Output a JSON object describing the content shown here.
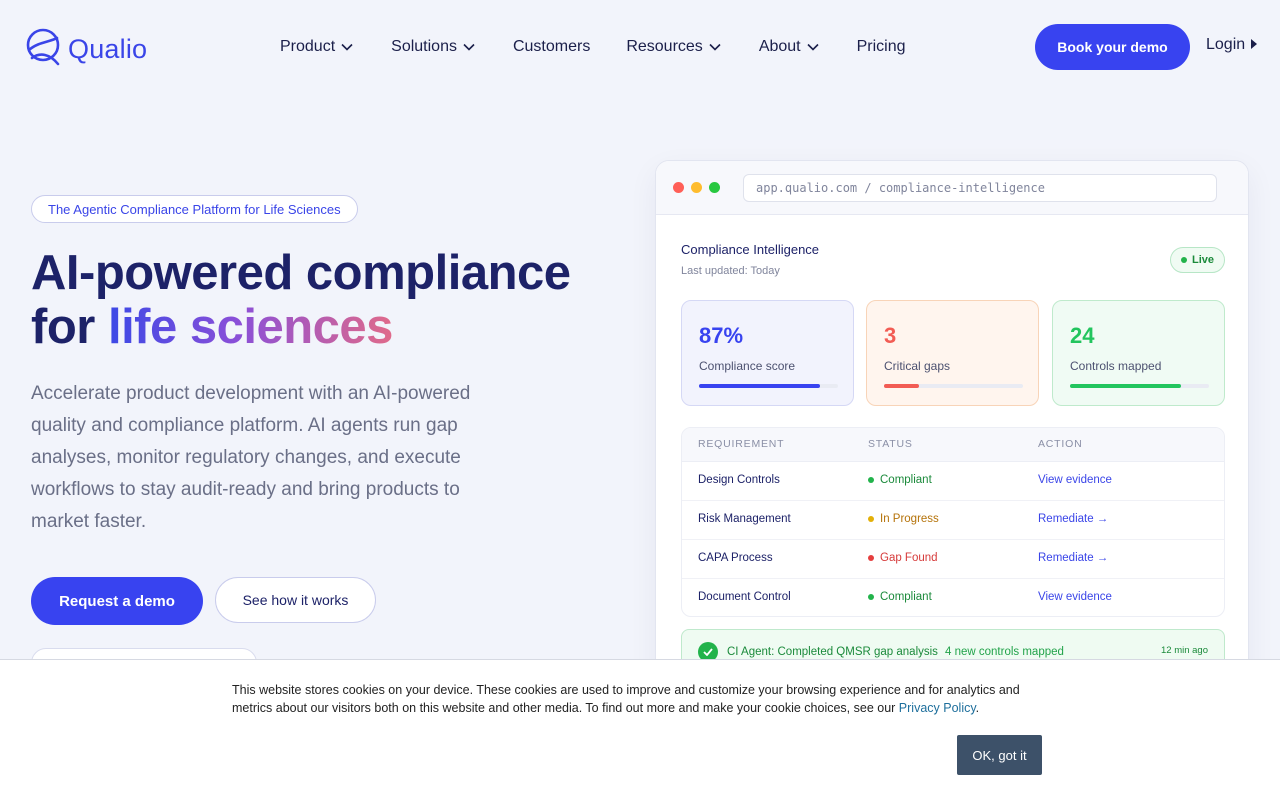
{
  "brand": {
    "name": "Qualio",
    "accent": "#3843f0"
  },
  "nav": {
    "items": [
      {
        "label": "Product",
        "has_menu": true
      },
      {
        "label": "Solutions",
        "has_menu": true
      },
      {
        "label": "Customers",
        "has_menu": false
      },
      {
        "label": "Resources",
        "has_menu": true
      },
      {
        "label": "About",
        "has_menu": true
      },
      {
        "label": "Pricing",
        "has_menu": false
      }
    ],
    "cta_label": "Book your demo",
    "login_label": "Login"
  },
  "hero": {
    "pill": "The Agentic Compliance Platform for Life Sciences",
    "headline_line1": "AI-powered compliance",
    "headline_line2_prefix": "for",
    "headline_line2_highlight": "life sciences",
    "subtext": "Accelerate product development with an AI-powered quality and compliance platform. AI agents run gap analyses, monitor regulatory changes, and execute workflows to stay audit-ready and bring products to market faster.",
    "primary_cta": "Request a demo",
    "secondary_cta": "See how it works"
  },
  "mock": {
    "url": "app.qualio.com / compliance-intelligence",
    "title": "Compliance Intelligence",
    "updated": "Last updated: Today",
    "live_label": "Live",
    "cards": [
      {
        "value": "87%",
        "label": "Compliance score",
        "progress": 0.87,
        "color": "#3843f0",
        "bg": "#f2f3fd",
        "border": "#d5d8f5"
      },
      {
        "value": "3",
        "label": "Critical gaps",
        "progress": 0.25,
        "color": "#f25c54",
        "bg": "#fff5ee",
        "border": "#f8d4b8"
      },
      {
        "value": "24",
        "label": "Controls mapped",
        "progress": 0.8,
        "color": "#22c55e",
        "bg": "#f0fbf4",
        "border": "#bfeacc"
      }
    ],
    "table": {
      "headers": [
        "REQUIREMENT",
        "STATUS",
        "ACTION"
      ],
      "rows": [
        {
          "requirement": "Design Controls",
          "status": "Compliant",
          "status_color": "#1b8a3b",
          "dot": "#22b34b",
          "action": "View evidence"
        },
        {
          "requirement": "Risk Management",
          "status": "In Progress",
          "status_color": "#b5730a",
          "dot": "#e3b008",
          "action": "Remediate →"
        },
        {
          "requirement": "CAPA Process",
          "status": "Gap Found",
          "status_color": "#d63a3a",
          "dot": "#e53e3e",
          "action": "Remediate →"
        },
        {
          "requirement": "Document Control",
          "status": "Compliant",
          "status_color": "#1b8a3b",
          "dot": "#22b34b",
          "action": "View evidence"
        }
      ]
    },
    "agent": {
      "message": "CI Agent: Completed QMSR gap analysis",
      "detail": "4 new controls mapped",
      "time": "12 min ago"
    }
  },
  "cookie": {
    "text": "This website stores cookies on your device. These cookies are used to improve and customize your browsing experience and for analytics and metrics about our visitors both on this website and other media. To find out more and make your cookie choices, see our",
    "link": "Privacy Policy",
    "button": "OK, got it"
  }
}
